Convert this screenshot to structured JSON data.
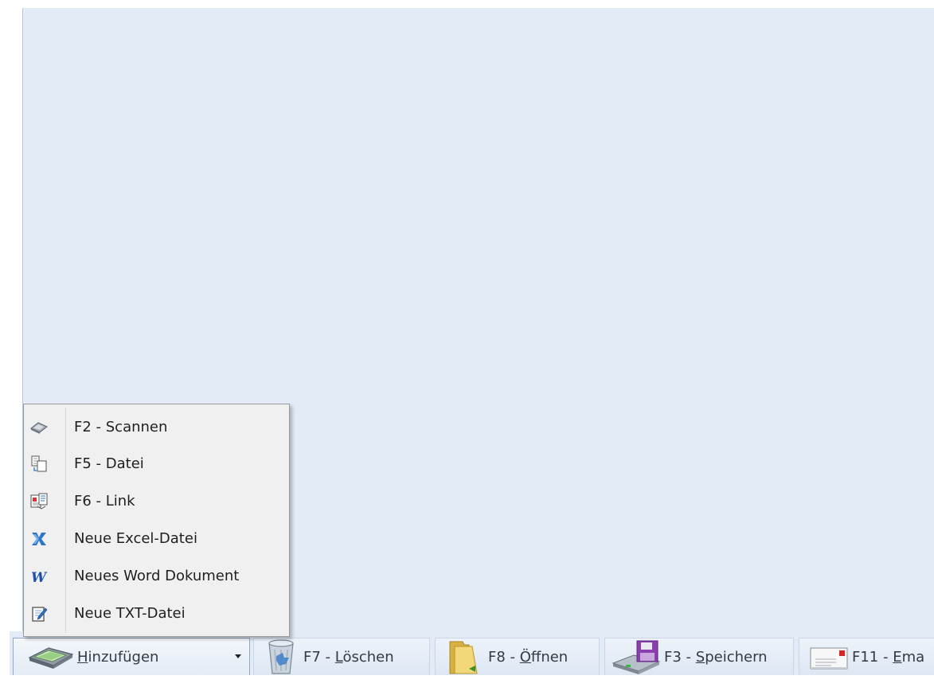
{
  "menu": {
    "items": [
      {
        "label": "F2 - Scannen",
        "icon": "scanner-icon"
      },
      {
        "label": "F5 - Datei",
        "icon": "file-copy-icon"
      },
      {
        "label": "F6 - Link",
        "icon": "link-icon"
      },
      {
        "label": "Neue Excel-Datei",
        "icon": "excel-icon"
      },
      {
        "label": "Neues Word Dokument",
        "icon": "word-icon"
      },
      {
        "label": "Neue TXT-Datei",
        "icon": "text-file-icon"
      }
    ]
  },
  "toolbar": {
    "add": {
      "mnemonic": "H",
      "rest": "inzufügen",
      "icon": "scanner-icon"
    },
    "delete": {
      "prefix": "F7 - ",
      "mnemonic": "L",
      "rest": "öschen",
      "icon": "recycle-bin-icon"
    },
    "open": {
      "prefix": "F8 - ",
      "mnemonic": "Ö",
      "rest": "ffnen",
      "icon": "folder-icon"
    },
    "save": {
      "prefix": "F3 - ",
      "mnemonic": "S",
      "rest": "peichern",
      "icon": "floppy-drive-icon"
    },
    "email": {
      "prefix": "F11 - ",
      "mnemonic": "E",
      "rest": "ma",
      "icon": "envelope-icon"
    }
  },
  "colors": {
    "background": "#e2ebf6",
    "menu_background": "#f0f0f0",
    "excel_green": "#1e7a3c",
    "word_blue": "#1f4fa8"
  }
}
